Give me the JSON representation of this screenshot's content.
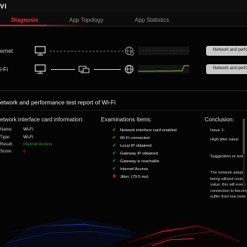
{
  "header": {
    "title_fragment": "VI"
  },
  "tabs": [
    {
      "label": "Diagnosis",
      "active": true
    },
    {
      "label": "App Topology",
      "active": false
    },
    {
      "label": "App Statistics",
      "active": false
    }
  ],
  "topology": {
    "ethernet": {
      "label": "ernet",
      "button": "Network and perfor"
    },
    "wifi": {
      "label": "i-Fi",
      "button": "Network and perfor"
    }
  },
  "report": {
    "title": "etwork and performance test report of Wi-Fi",
    "nic": {
      "heading": "etwork interface card information:",
      "rows": [
        {
          "key": "Name:",
          "value": "Wi-Fi",
          "color": "#e6e6e6"
        },
        {
          "key": "Type:",
          "value": "Wi-Fi",
          "color": "#e6e6e6"
        },
        {
          "key": "Result:",
          "value": "Internet Access",
          "color": "#2aa52a"
        },
        {
          "key": "Score:",
          "value": "6",
          "color": "#d8162a"
        }
      ]
    },
    "examinations": {
      "heading": "Examinations Items:",
      "items": [
        {
          "text": "Network interface card enabled",
          "ok": true
        },
        {
          "text": "Wi-Fi connected",
          "ok": true
        },
        {
          "text": "Local IP obtained",
          "ok": true
        },
        {
          "text": "Gateway IP obtained",
          "ok": true
        },
        {
          "text": "Gateway is reachable",
          "ok": true
        },
        {
          "text": "Internet Access",
          "ok": true
        },
        {
          "text": "Jitter: (79.5 ms)",
          "ok": false
        }
      ]
    },
    "conclusion": {
      "heading": "Conclusion:",
      "issue": "Issue 1:",
      "issue_text": "High jitter value",
      "suggestion": "Suggestion or solut",
      "body": [
        "The network adapte",
        "being utilized could",
        "value; this will event",
        "connection to becom",
        "suffer from low netw"
      ]
    }
  },
  "colors": {
    "accent": "#d8162a",
    "ok": "#2aa52a",
    "fail": "#d8162a",
    "graph_line": "#7fbf3a"
  },
  "icons": [
    "computer-icon",
    "globe-icon",
    "router-icon",
    "check-icon",
    "cross-icon"
  ]
}
